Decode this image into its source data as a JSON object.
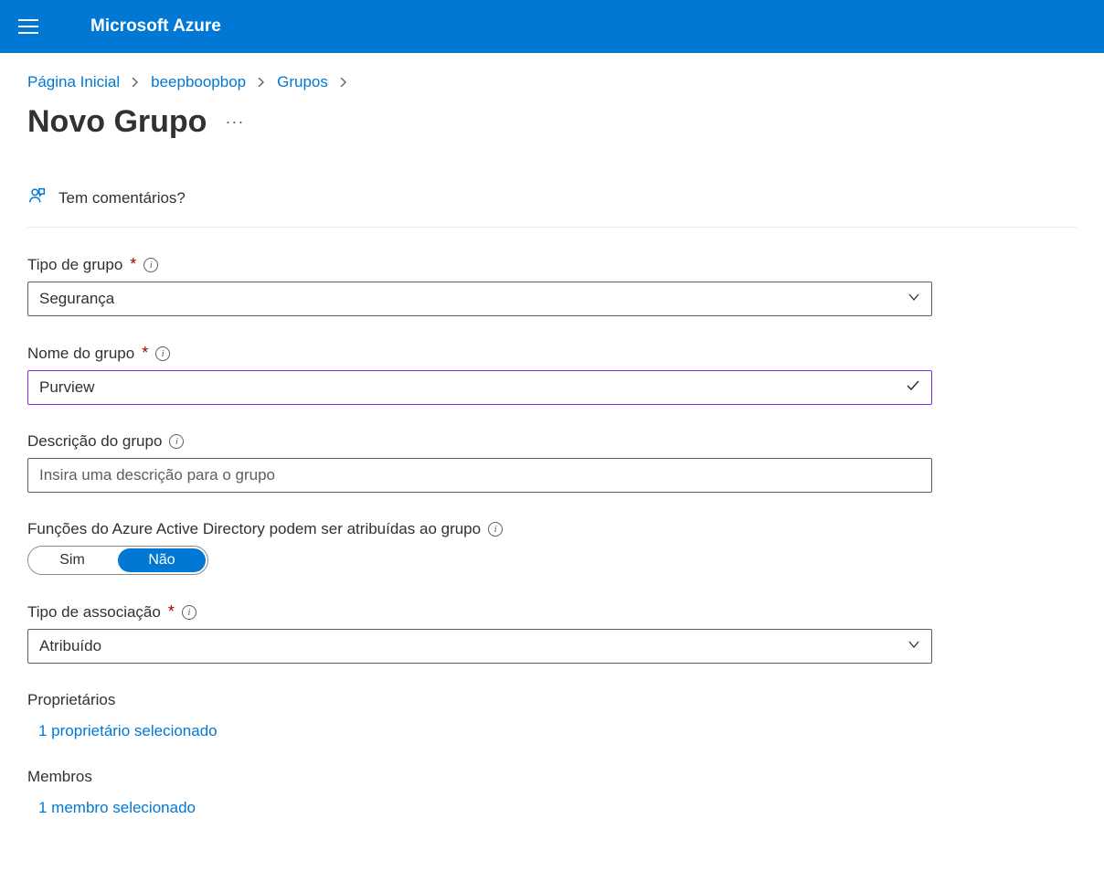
{
  "header": {
    "brand": "Microsoft Azure"
  },
  "breadcrumb": {
    "items": [
      "Página Inicial",
      "beepboopbop",
      "Grupos"
    ]
  },
  "page": {
    "title": "Novo Grupo"
  },
  "feedback": {
    "text": "Tem comentários?"
  },
  "form": {
    "group_type": {
      "label": "Tipo de grupo",
      "value": "Segurança"
    },
    "group_name": {
      "label": "Nome do grupo",
      "value": "Purview"
    },
    "group_description": {
      "label": "Descrição do grupo",
      "placeholder": "Insira uma descrição para o grupo"
    },
    "aad_roles": {
      "label": "Funções do Azure Active Directory podem ser atribuídas ao grupo",
      "yes": "Sim",
      "no": "Não"
    },
    "membership_type": {
      "label": "Tipo de associação",
      "value": "Atribuído"
    },
    "owners": {
      "label": "Proprietários",
      "link": "1 proprietário selecionado"
    },
    "members": {
      "label": "Membros",
      "link": "1 membro selecionado"
    }
  }
}
